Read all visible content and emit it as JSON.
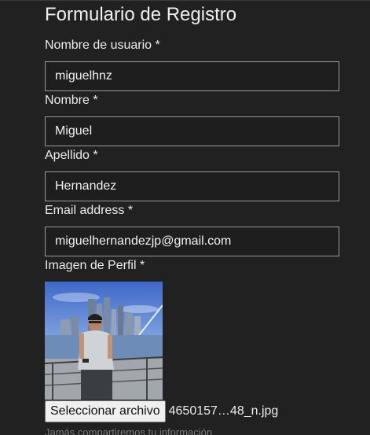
{
  "form": {
    "title": "Formulario de Registro",
    "username": {
      "label": "Nombre de usuario *",
      "value": "miguelhnz"
    },
    "first_name": {
      "label": "Nombre *",
      "value": "Miguel"
    },
    "last_name": {
      "label": "Apellido *",
      "value": "Hernandez"
    },
    "email": {
      "label": "Email address *",
      "value": "miguelhernandezjp@gmail.com"
    },
    "profile_image": {
      "label": "Imagen de Perfil *",
      "button_label": "Seleccionar archivo",
      "file_name": "4650157…48_n.jpg"
    },
    "help_text": "Jamás compartiremos tu información"
  },
  "colors": {
    "background": "#212121",
    "text": "#ececec",
    "input_border": "#9a9a9a",
    "muted": "#7a7a7a"
  }
}
